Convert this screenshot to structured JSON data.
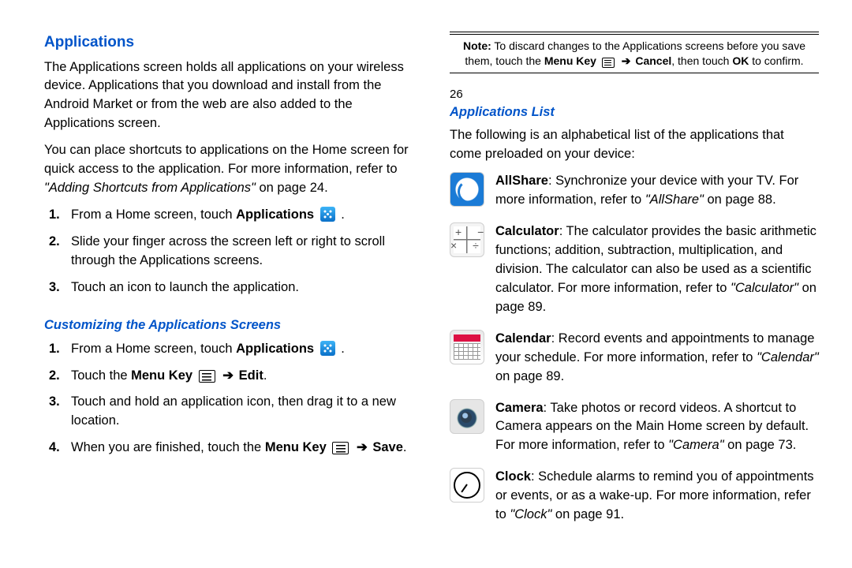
{
  "left": {
    "heading": "Applications",
    "p1": "The Applications screen holds all applications on your wireless device. Applications that you download and install from the Android Market or from the web are also added to the Applications screen.",
    "p2a": "You can place shortcuts to applications on the Home screen for quick access to the application. For more information, refer to ",
    "p2ref": "\"Adding Shortcuts from Applications\"",
    "p2b": "  on page 24.",
    "steps1": {
      "s1a": "From a Home screen, touch ",
      "s1b": "Applications",
      "s1c": " .",
      "s2": "Slide your finger across the screen left or right to scroll through the Applications screens.",
      "s3": "Touch an icon to launch the application."
    },
    "sub1": "Customizing the Applications Screens",
    "steps2": {
      "s1a": "From a Home screen, touch ",
      "s1b": "Applications",
      "s1c": " .",
      "s2a": "Touch the ",
      "s2b": "Menu Key",
      "s2arrow": " ➔ ",
      "s2c": "Edit",
      "s2d": ".",
      "s3": "Touch and hold an application icon, then drag it to a new location.",
      "s4a": "When you are finished, touch the ",
      "s4b": "Menu Key",
      "s4arrow": " ➔ ",
      "s4c": "Save",
      "s4d": "."
    },
    "note": {
      "label": "Note:",
      "a": " To discard changes to the Applications screens before you save them, touch the ",
      "b": "Menu Key",
      "arrow": " ➔ ",
      "c": "Cancel",
      "d": ", then touch ",
      "e": "OK",
      "f": " to confirm."
    },
    "pagenum": "26"
  },
  "right": {
    "heading": "Applications List",
    "intro": "The following is an alphabetical list of the applications that come preloaded on your device:",
    "apps": {
      "allshare": {
        "name": "AllShare",
        "a": ": Synchronize your device with your TV. For more information, refer to ",
        "ref": "\"AllShare\"",
        "b": "  on page 88."
      },
      "calc": {
        "name": "Calculator",
        "a": ": The calculator provides the basic arithmetic functions; addition, subtraction, multiplication, and division. The calculator can also be used as a scientific calculator. For more information, refer to ",
        "ref": "\"Calculator\"",
        "b": "  on page 89."
      },
      "cal": {
        "name": "Calendar",
        "a": ": Record events and appointments to manage your schedule. For more information, refer to ",
        "ref": "\"Calendar\"",
        "b": "  on page 89."
      },
      "cam": {
        "name": "Camera",
        "a": ": Take photos or record videos. A shortcut to Camera appears on the Main Home screen by default. For more information, refer to ",
        "ref": "\"Camera\"",
        "b": "  on page 73."
      },
      "clock": {
        "name": "Clock",
        "a": ": Schedule alarms to remind you of appointments or events, or as a wake-up. For more information, refer to ",
        "ref": "\"Clock\"",
        "b": "  on page 91."
      }
    }
  }
}
